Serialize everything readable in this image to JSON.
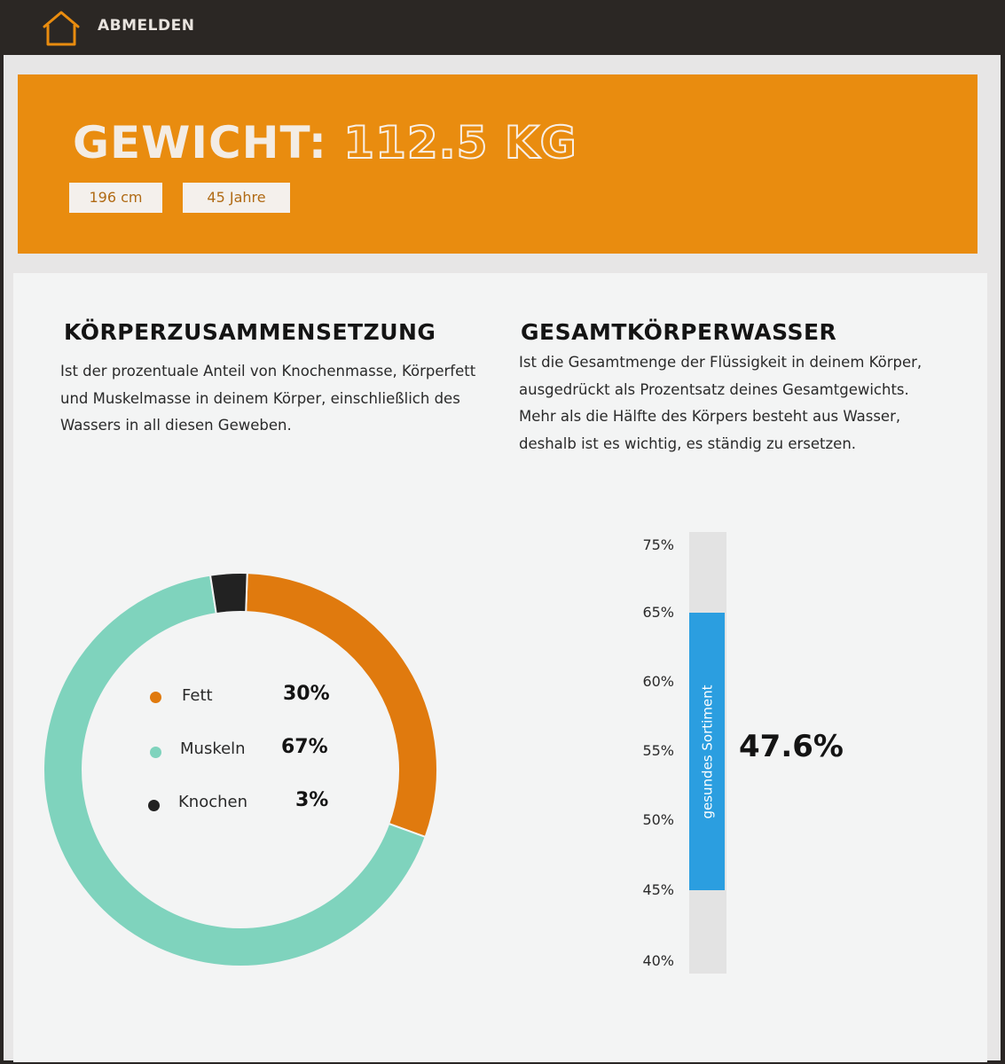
{
  "header": {
    "home_icon": "house-outline-icon",
    "logout_label": "ABMELDEN"
  },
  "hero": {
    "weight_label": "GEWICHT:",
    "weight_value": "112.5 KG",
    "height_chip": "196 cm",
    "age_chip": "45 Jahre"
  },
  "composition": {
    "title": "KÖRPERZUSAMMENSETZUNG",
    "description": "Ist der prozentuale Anteil von Knochenmasse, Körperfett und Muskelmasse in deinem Körper, einschließlich des Wassers in all diesen Geweben.",
    "legend": [
      {
        "label": "Fett",
        "value": "30%"
      },
      {
        "label": "Muskeln",
        "value": "67%"
      },
      {
        "label": "Knochen",
        "value": "3%"
      }
    ]
  },
  "water": {
    "title": "GESAMTKÖRPERWASSER",
    "description": "Ist die Gesamtmenge der Flüssigkeit in deinem Körper, ausgedrückt als Prozentsatz deines Gesamtgewichts. Mehr als die Hälfte des Körpers besteht aus Wasser, deshalb ist es wichtig, es ständig zu ersetzen.",
    "scale_labels": [
      "75%",
      "65%",
      "60%",
      "55%",
      "50%",
      "45%",
      "40%"
    ],
    "range_label": "gesundes Sortiment",
    "value_label": "47.6%"
  },
  "colors": {
    "accent_orange": "#e98c0f",
    "fat": "#e07a0e",
    "muscle": "#7fd3bd",
    "bone": "#222222",
    "range_blue": "#2b9ee0"
  },
  "chart_data": [
    {
      "type": "pie",
      "categories": [
        "Fett",
        "Muskeln",
        "Knochen"
      ],
      "values": [
        30,
        67,
        3
      ],
      "colors": [
        "#e07a0e",
        "#7fd3bd",
        "#222222"
      ]
    },
    {
      "type": "bar",
      "ticks": [
        75,
        65,
        60,
        55,
        50,
        45,
        40
      ],
      "ylim": [
        40,
        75
      ],
      "range": [
        45,
        65
      ],
      "range_name": "gesundes Sortiment",
      "value": 47.6
    }
  ]
}
